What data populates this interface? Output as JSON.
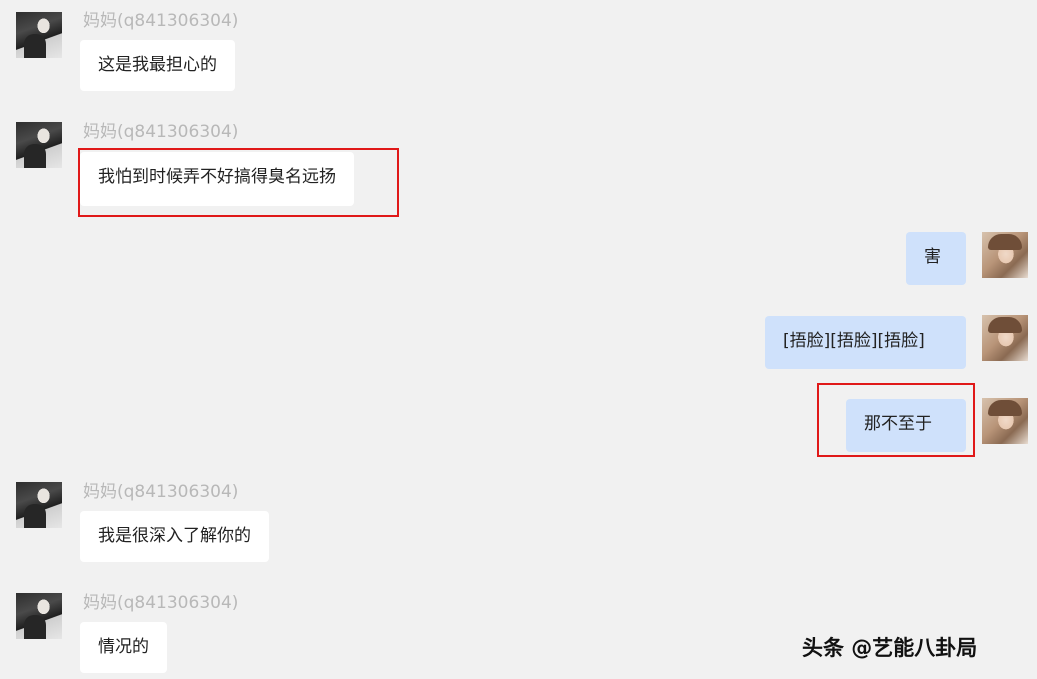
{
  "messages": [
    {
      "side": "in",
      "sender": "妈妈(q841306304)",
      "text": "这是我最担心的"
    },
    {
      "side": "in",
      "sender": "妈妈(q841306304)",
      "text": "我怕到时候弄不好搞得臭名远扬",
      "highlighted": true
    },
    {
      "side": "out",
      "text": "害"
    },
    {
      "side": "out",
      "text": "[捂脸][捂脸][捂脸]"
    },
    {
      "side": "out",
      "text": "那不至于",
      "highlighted": true
    },
    {
      "side": "in",
      "sender": "妈妈(q841306304)",
      "text": "我是很深入了解你的"
    },
    {
      "side": "in",
      "sender": "妈妈(q841306304)",
      "text": "情况的"
    }
  ],
  "watermark": "头条 @艺能八卦局",
  "colors": {
    "background": "#f1f1f1",
    "incoming_bubble": "#ffffff",
    "outgoing_bubble": "#cfe1fb",
    "highlight_border": "#e01818",
    "sender_name": "#b8b8b8"
  }
}
